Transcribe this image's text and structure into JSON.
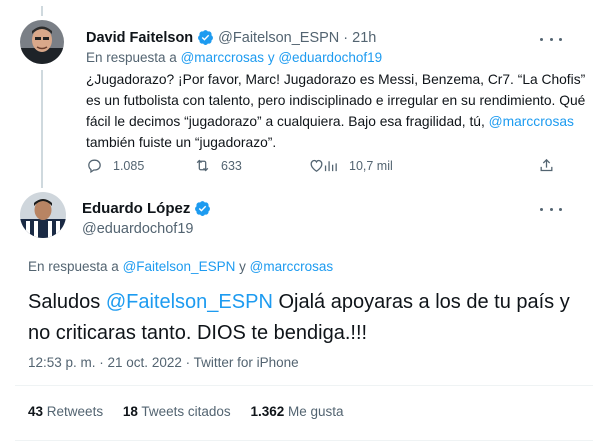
{
  "tweet1": {
    "name": "David Faitelson",
    "handle": "@Faitelson_ESPN",
    "separator": "·",
    "time": "21h",
    "reply_prefix": "En respuesta a",
    "reply_user1": "@marccrosas",
    "reply_and": "y",
    "reply_user2": "@eduardochof19",
    "text_part1": "¿Jugadorazo? ¡Por favor, Marc! Jugadorazo es Messi, Benzema, Cr7. “La Chofis” es un futbolista con talento, pero indisciplinado e irregular en su rendimiento. Qué fácil le decimos “jugadorazo” a cualquiera. Bajo esa fragilidad, tú,",
    "text_mention": "@marccrosas",
    "text_part2": "también fuiste un “jugadorazo”.",
    "replies": "1.085",
    "retweets": "633",
    "likes": "",
    "views": "10,7 mil"
  },
  "tweet2": {
    "name": "Eduardo López",
    "handle": "@eduardochof19",
    "reply_prefix": "En respuesta a",
    "reply_user1": "@Faitelson_ESPN",
    "reply_and": "y",
    "reply_user2": "@marccrosas",
    "text_part1": "Saludos",
    "text_mention": "@Faitelson_ESPN",
    "text_part2": "Ojalá apoyaras a los de tu país y no criticaras tanto. DIOS te bendiga.!!!",
    "meta": "12:53 p. m. · 21 oct. 2022 · Twitter for iPhone",
    "retweets_count": "43",
    "retweets_label": "Retweets",
    "quotes_count": "18",
    "quotes_label": "Tweets citados",
    "likes_count": "1.362",
    "likes_label": "Me gusta"
  },
  "colors": {
    "accent": "#1d9bf0",
    "text": "#0f1419",
    "secondary": "#536471",
    "divider": "#eff3f4"
  },
  "icons": [
    "verified-badge-icon",
    "more-icon",
    "reply-icon",
    "retweet-icon",
    "like-icon",
    "views-icon"
  ]
}
